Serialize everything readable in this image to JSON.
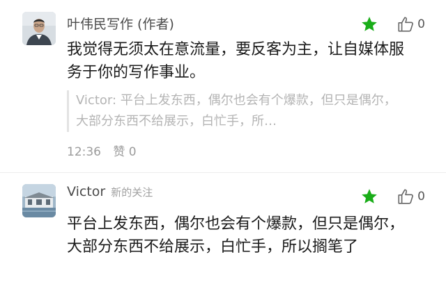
{
  "comment1": {
    "author": "叶伟民写作 (作者)",
    "text": "我觉得无须太在意流量，要反客为主，让自媒体服务于你的写作事业。",
    "quote": "Victor: 平台上发东西，偶尔也会有个爆款，但只是偶尔，大部分东西不给展示，白忙手，所…",
    "time": "12:36",
    "likes_label": "赞 0",
    "thumb_count": "0"
  },
  "comment2": {
    "author": "Victor",
    "tag": "新的关注",
    "text": "平台上发东西，偶尔也会有个爆款，但只是偶尔，大部分东西不给展示，白忙手，所以搁笔了",
    "thumb_count": "0"
  },
  "colors": {
    "star": "#1aad19",
    "meta": "#9b9b9b",
    "quote": "#b4b4b4"
  },
  "icons": [
    "avatar-photo",
    "star-icon",
    "thumb-up-icon"
  ]
}
